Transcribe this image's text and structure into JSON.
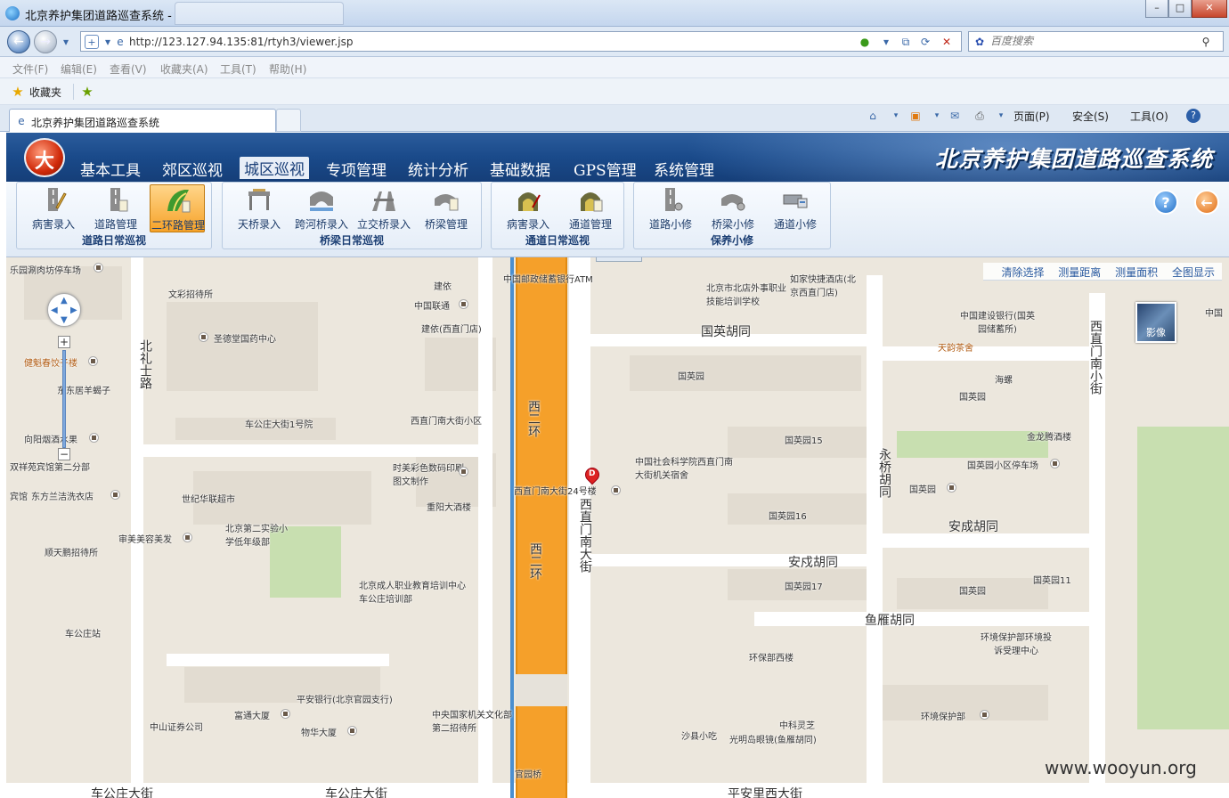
{
  "browser": {
    "window_title": "北京养护集团道路巡查系统 -",
    "url": "http://123.127.94.135:81/rtyh3/viewer.jsp",
    "search_placeholder": "百度搜索",
    "menus": [
      "文件(F)",
      "编辑(E)",
      "查看(V)",
      "收藏夹(A)",
      "工具(T)",
      "帮助(H)"
    ],
    "favorites_label": "收藏夹",
    "tab_title": "北京养护集团道路巡查系统",
    "commands": [
      "页面(P)",
      "安全(S)",
      "工具(O)"
    ]
  },
  "app": {
    "title": "北京养护集团道路巡查系统",
    "logo_char": "大",
    "nav": [
      "基本工具",
      "郊区巡视",
      "城区巡视",
      "专项管理",
      "统计分析",
      "基础数据",
      "GPS管理",
      "系统管理"
    ],
    "active_nav": "城区巡视",
    "groups": [
      {
        "label": "道路日常巡视",
        "tools": [
          "病害录入",
          "道路管理",
          "二环路管理"
        ]
      },
      {
        "label": "桥梁日常巡视",
        "tools": [
          "天桥录入",
          "跨河桥录入",
          "立交桥录入",
          "桥梁管理"
        ]
      },
      {
        "label": "通道日常巡视",
        "tools": [
          "病害录入",
          "通道管理"
        ]
      },
      {
        "label": "保养小修",
        "tools": [
          "道路小修",
          "桥梁小修",
          "通道小修"
        ]
      }
    ],
    "help_glyph": "?",
    "back_glyph": "←"
  },
  "map": {
    "tools": [
      "清除选择",
      "测量距离",
      "测量面积",
      "全图显示"
    ],
    "satellite_label": "影像",
    "streets": [
      "国英胡同",
      "安成胡同",
      "安戍胡同",
      "鱼雁胡同",
      "北礼士路",
      "西直门南大街",
      "永桥胡同",
      "西直门南小街",
      "车公庄大街",
      "车公庄大街",
      "平安里西大街",
      "西二环",
      "西二环"
    ],
    "labels": [
      "乐园涮肉坊停车场",
      "文彩招待所",
      "圣德堂国药中心",
      "健魁春饺子楼",
      "东东居羊蝎子",
      "向阳烟酒水果",
      "双祥苑宾馆第二分部",
      "宾馆",
      "东方兰洁洗衣店",
      "世纪华联超市",
      "车公庄大街1号院",
      "北京第二实验小学低年级部",
      "审美美容美发",
      "顺天鹏招待所",
      "车公庄站",
      "北京成人职业教育培训中心车公庄培训部",
      "建依",
      "中国联通",
      "建依(西直门店)",
      "西直门南大街小区",
      "时美彩色数码印刷图文制作",
      "重阳大酒楼",
      "平安银行(北京官园支行)",
      "富通大厦",
      "物华大厦",
      "中山证券公司",
      "中央国家机关文化部第二招待所",
      "官园桥",
      "中国邮政储蓄银行ATM",
      "北京市北店外事职业技能培训学校",
      "如家快捷酒店(北京西直门店)",
      "国英园",
      "国英园15",
      "中国社会科学院西直门南大街机关宿舍",
      "西直门南大街24号楼",
      "国英园16",
      "国英园17",
      "环保部西楼",
      "中科灵芝",
      "沙县小吃",
      "光明岛眼镜(鱼雁胡同)",
      "中国建设银行(国英园储蓄所)",
      "天韵茶舍",
      "海螺",
      "国英园",
      "金龙腾酒楼",
      "国英园小区停车场",
      "国英园",
      "国英园",
      "国英园11",
      "环境保护部环境投诉受理中心",
      "环境保护部",
      "中国",
      "中国"
    ],
    "marker_label": "D",
    "watermark": "www.wooyun.org"
  }
}
